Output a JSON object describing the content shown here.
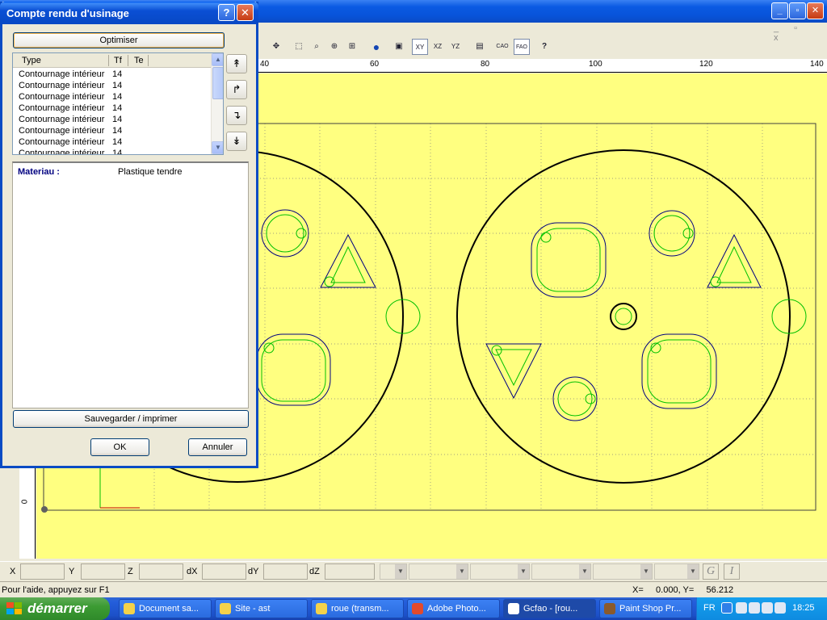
{
  "app": {
    "minimize_icon": "minimize-icon",
    "maximize_icon": "maximize-icon",
    "close_icon": "close-icon"
  },
  "mdi": {
    "controls": "_ ▫ x"
  },
  "toolbar": {
    "buttons": [
      "zoom-reset-icon",
      "zoom-window-icon",
      "zoom-page-icon",
      "zoom-in-icon",
      "zoom-all-icon",
      "globe-icon",
      "view-3d-icon",
      "view-xy-icon",
      "view-xz-icon",
      "view-yz-icon",
      "window-icon",
      "cao-icon",
      "fao-icon",
      "help-cursor-icon"
    ],
    "labels": [
      "",
      "",
      "",
      "",
      "",
      "",
      "",
      "XY",
      "XZ",
      "YZ",
      "",
      "CAO",
      "FAO",
      "?"
    ]
  },
  "ruler_top": {
    "ticks": [
      "40",
      "60",
      "80",
      "100",
      "120",
      "140"
    ]
  },
  "ruler_left": {
    "zero": "0"
  },
  "coords": {
    "labels": [
      "X",
      "Y",
      "Z",
      "dX",
      "dY",
      "dZ"
    ],
    "g_button": "G",
    "i_button": "I"
  },
  "status": {
    "help_text": "Pour l'aide, appuyez sur F1",
    "coords_text": "X=     0.000, Y=     56.212"
  },
  "taskbar": {
    "start_label": "démarrer",
    "items": [
      {
        "label": "Document sa...",
        "color": "#f4d24a"
      },
      {
        "label": "Site - ast",
        "color": "#f4d24a"
      },
      {
        "label": "roue (transm...",
        "color": "#f4d24a"
      },
      {
        "label": "Adobe Photo...",
        "color": "#e24a2c"
      },
      {
        "label": "Gcfao - [rou...",
        "color": "#ffffff"
      },
      {
        "label": "Paint Shop Pr...",
        "color": "#8a5a2c"
      }
    ],
    "lang": "FR",
    "clock": "18:25"
  },
  "dialog": {
    "title": "Compte rendu d'usinage",
    "help_label": "?",
    "close_label": "✕",
    "optimiser_label": "Optimiser",
    "columns": {
      "type": "Type",
      "tf": "Tf",
      "te": "Te"
    },
    "operations": [
      {
        "type": "Contournage intérieur",
        "tf": "14"
      },
      {
        "type": "Contournage intérieur",
        "tf": "14"
      },
      {
        "type": "Contournage intérieur",
        "tf": "14"
      },
      {
        "type": "Contournage intérieur",
        "tf": "14"
      },
      {
        "type": "Contournage intérieur",
        "tf": "14"
      },
      {
        "type": "Contournage intérieur",
        "tf": "14"
      },
      {
        "type": "Contournage intérieur",
        "tf": "14"
      },
      {
        "type": "Contournage intérieur",
        "tf": "14"
      }
    ],
    "order_buttons": [
      "↟",
      "↱",
      "↴",
      "↡"
    ],
    "material_label": "Materiau :",
    "material_value": "Plastique tendre",
    "save_label": "Sauvegarder / imprimer",
    "ok_label": "OK",
    "cancel_label": "Annuler"
  },
  "colors": {
    "canvas": "#ffff80",
    "geometry": "#000080",
    "toolpath": "#00c000",
    "grid": "#808080"
  }
}
